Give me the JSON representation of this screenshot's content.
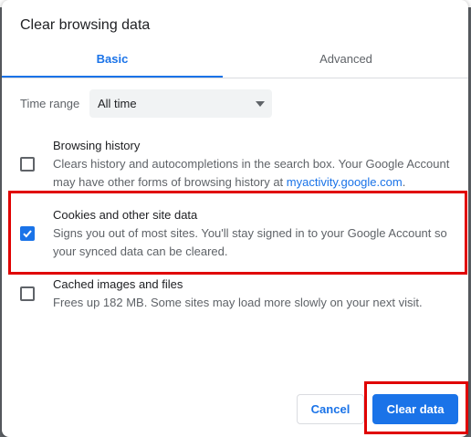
{
  "dialog": {
    "title": "Clear browsing data",
    "tabs": [
      {
        "label": "Basic",
        "selected": true
      },
      {
        "label": "Advanced",
        "selected": false
      }
    ],
    "time_range": {
      "label": "Time range",
      "value": "All time"
    },
    "options": [
      {
        "title": "Browsing history",
        "description_prefix": "Clears history and autocompletions in the search box. Your Google Account may have other forms of browsing history at ",
        "link_text": "myactivity.google.com",
        "description_suffix": ".",
        "checked": false
      },
      {
        "title": "Cookies and other site data",
        "description": "Signs you out of most sites. You'll stay signed in to your Google Account so your synced data can be cleared.",
        "checked": true
      },
      {
        "title": "Cached images and files",
        "description": "Frees up 182 MB. Some sites may load more slowly on your next visit.",
        "checked": false
      }
    ],
    "buttons": {
      "cancel": "Cancel",
      "confirm": "Clear data"
    }
  },
  "colors": {
    "accent": "#1a73e8",
    "highlight": "#e00000"
  }
}
